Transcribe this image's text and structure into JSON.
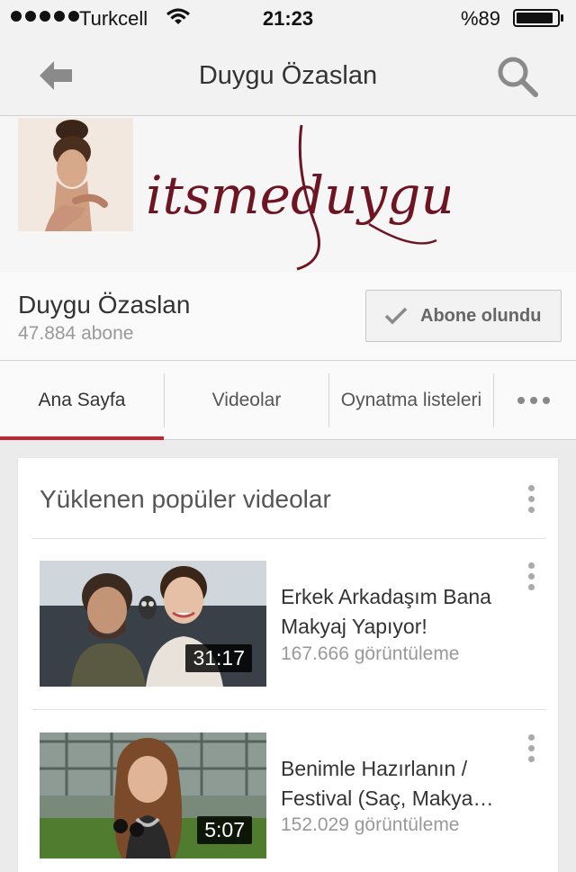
{
  "status_bar": {
    "carrier": "Turkcell",
    "time": "21:23",
    "battery": "%89"
  },
  "nav": {
    "title": "Duygu Özaslan",
    "back_icon": "back-arrow-icon",
    "search_icon": "search-icon"
  },
  "banner": {
    "logo_text": "itsmeduygu"
  },
  "channel": {
    "name": "Duygu Özaslan",
    "subscribers": "47.884 abone",
    "subscribe_label": "Abone olundu"
  },
  "tabs": [
    {
      "label": "Ana Sayfa",
      "active": true
    },
    {
      "label": "Videolar",
      "active": false
    },
    {
      "label": "Oynatma listeleri",
      "active": false
    }
  ],
  "section": {
    "title": "Yüklenen popüler videolar",
    "videos": [
      {
        "title": "Erkek Arkadaşım Bana Makyaj Yapıyor!",
        "views": "167.666 görüntüleme",
        "duration": "31:17"
      },
      {
        "title": "Benimle Hazırlanın / Festival (Saç, Makya…",
        "views": "152.029 görüntüleme",
        "duration": "5:07"
      }
    ]
  },
  "colors": {
    "accent": "#c1272d",
    "logo": "#6e1523"
  }
}
